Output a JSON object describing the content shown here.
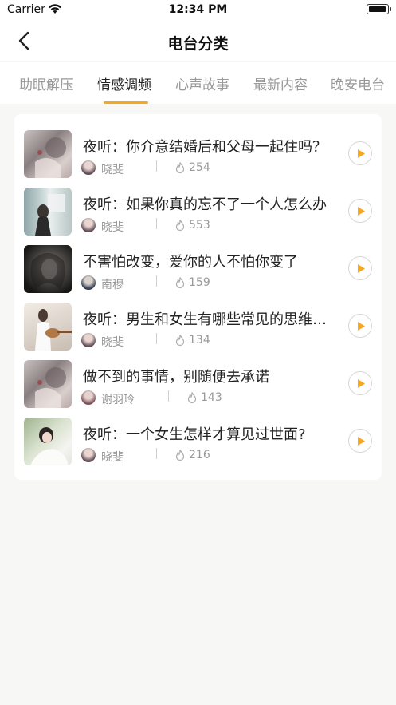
{
  "status": {
    "carrier": "Carrier",
    "time": "12:34 PM"
  },
  "nav": {
    "title": "电台分类"
  },
  "tabs": [
    {
      "label": "助眠解压",
      "active": false
    },
    {
      "label": "情感调频",
      "active": true
    },
    {
      "label": "心声故事",
      "active": false
    },
    {
      "label": "最新内容",
      "active": false
    },
    {
      "label": "晚安电台",
      "active": false
    }
  ],
  "accent": "#f7a821",
  "items": [
    {
      "title": "夜听：你介意结婚后和父母一起住吗？",
      "author": "晓斐",
      "count": "254"
    },
    {
      "title": "夜听：如果你真的忘不了一个人怎么办",
      "author": "晓斐",
      "count": "553"
    },
    {
      "title": "不害怕改变，爱你的人不怕你变了",
      "author": "南穆",
      "count": "159"
    },
    {
      "title": "夜听：男生和女生有哪些常见的思维差异",
      "author": "晓斐",
      "count": "134"
    },
    {
      "title": "做不到的事情，别随便去承诺",
      "author": "谢羽玲",
      "count": "143"
    },
    {
      "title": "夜听：一个女生怎样才算见过世面?",
      "author": "晓斐",
      "count": "216"
    }
  ]
}
